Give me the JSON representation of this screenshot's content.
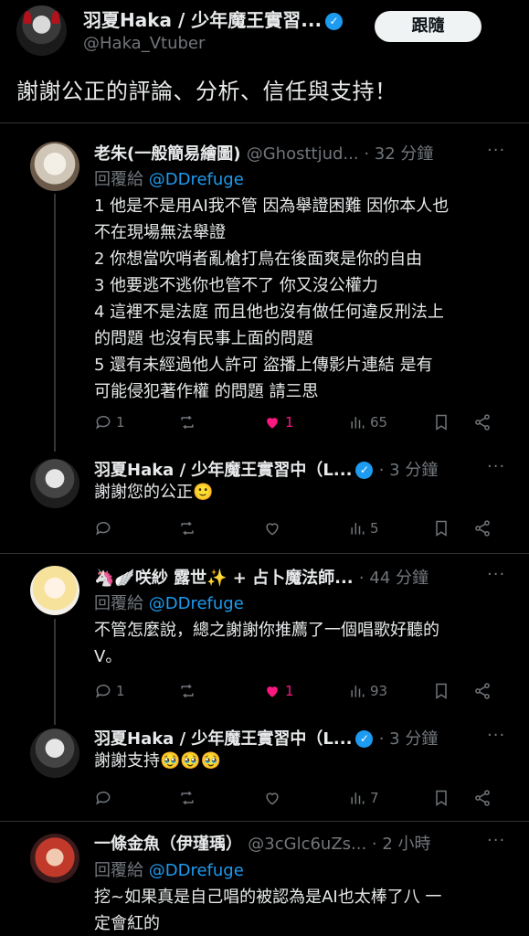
{
  "main": {
    "name": "羽夏Haka / 少年魔王實習...",
    "handle": "@Haka_Vtuber",
    "follow_label": "跟隨",
    "text": "謝謝公正的評論、分析、信任與支持！"
  },
  "replies": [
    {
      "name": "老朱(一般簡易繪圖)",
      "meta": "@Ghosttjud... · 32 分鐘",
      "replying_prefix": "回覆給",
      "replying_to": "@DDrefuge",
      "lines": [
        "1 他是不是用AI我不管 因為舉證困難 因你本人也",
        "不在現場無法舉證",
        "2 你想當吹哨者亂槍打鳥在後面爽是你的自由",
        "3 他要逃不逃你也管不了 你又沒公權力",
        "4 這裡不是法庭 而且他也沒有做任何違反刑法上",
        "的問題 也沒有民事上面的問題",
        "5 還有未經過他人許可 盜播上傳影片連結 是有",
        "可能侵犯著作權 的問題 請三思"
      ],
      "reply_count": "1",
      "retweet_count": "",
      "like_count": "1",
      "view_count": "65"
    },
    {
      "name": "羽夏Haka / 少年魔王實習中（L...",
      "meta": "· 3 分鐘",
      "lines": [
        "謝謝您的公正🙂"
      ],
      "reply_count": "",
      "retweet_count": "",
      "like_count": "",
      "view_count": "5"
    },
    {
      "name": "🦄🪽咲紗 露世✨ + 占卜魔法師...",
      "meta": "· 44 分鐘",
      "replying_prefix": "回覆給",
      "replying_to": "@DDrefuge",
      "lines": [
        "不管怎麼說，總之謝謝你推薦了一個唱歌好聽的",
        "V。"
      ],
      "reply_count": "1",
      "retweet_count": "",
      "like_count": "1",
      "view_count": "93"
    },
    {
      "name": "羽夏Haka / 少年魔王實習中（L...",
      "meta": "· 3 分鐘",
      "lines": [
        "謝謝支持🥹🥹🥹"
      ],
      "reply_count": "",
      "retweet_count": "",
      "like_count": "",
      "view_count": "7"
    },
    {
      "name": "一條金魚（伊瑾瑀）",
      "meta": "@3cGlc6uZs... · 2 小時",
      "replying_prefix": "回覆給",
      "replying_to": "@DDrefuge",
      "lines": [
        "挖~如果真是自己唱的被認為是AI也太棒了八 一",
        "定會紅的"
      ]
    }
  ],
  "more_label": "···"
}
